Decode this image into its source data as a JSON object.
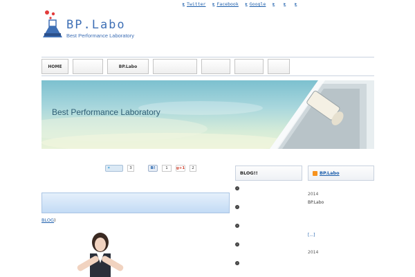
{
  "header": {
    "links": [
      {
        "label": "Twitter"
      },
      {
        "label": "Facebook"
      },
      {
        "label": "Google"
      },
      {
        "label": ""
      },
      {
        "label": ""
      },
      {
        "label": ""
      }
    ],
    "logo": {
      "main": "BP.Labo",
      "sub": "Best Performance Laboratory"
    },
    "tagline": "",
    "site_description": ""
  },
  "nav": {
    "items": [
      {
        "label": "HOME"
      },
      {
        "label": ""
      },
      {
        "label": "BP.Labo"
      },
      {
        "label": ""
      },
      {
        "label": ""
      },
      {
        "label": ""
      },
      {
        "label": ""
      }
    ]
  },
  "hero": {
    "title": "Best Performance Laboratory",
    "subtitle": ""
  },
  "social": {
    "tweet_label": "",
    "tweet_count": "3",
    "hatena_label": "B!",
    "hatena_count": "1",
    "gplus_label": "g+1",
    "gplus_count": "2"
  },
  "post": {
    "title": "",
    "source_prefix": "",
    "source_link": "BLOG",
    "source_suffix": ")",
    "text": ""
  },
  "sidebar_blog": {
    "title": "BLOG!!",
    "items": [
      {
        "text": ""
      },
      {
        "text": ""
      },
      {
        "text": ""
      },
      {
        "text": ""
      },
      {
        "text": ""
      }
    ]
  },
  "sidebar_rss": {
    "title": "BP.Labo",
    "entry_title": "",
    "date": "2014",
    "body": "BP.Labo",
    "more": "[...]",
    "entry2_title": "",
    "date2": "2014"
  },
  "colors": {
    "accent": "#3e6fb5",
    "link": "#1a5dab",
    "rss": "#f7931e"
  }
}
